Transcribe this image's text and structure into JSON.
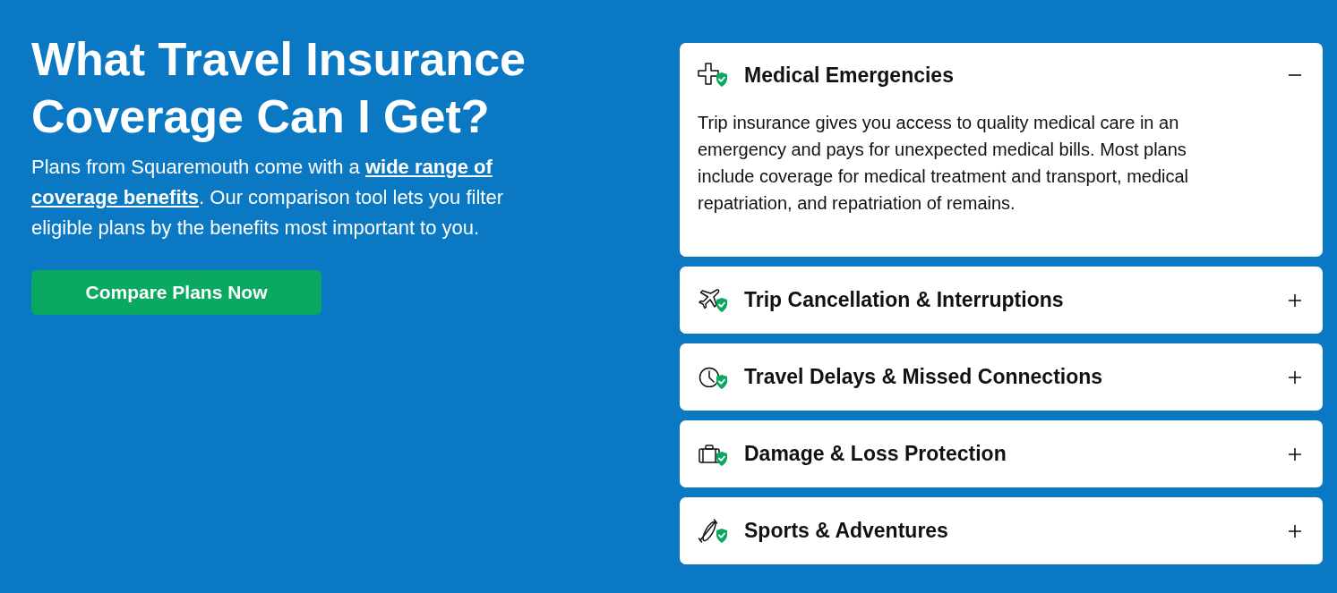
{
  "heading": {
    "title": "What Travel Insurance Coverage Can I Get?"
  },
  "intro": {
    "before": "Plans from Squaremouth come with a ",
    "link_parts": [
      "wide range of",
      "coverage benefits"
    ],
    "after": ". Our comparison tool lets you filter eligible plans by the benefits most important to you."
  },
  "cta": {
    "label": "Compare Plans Now"
  },
  "coverage_items": [
    {
      "title": "Medical Emergencies",
      "expanded": true,
      "body": "Trip insurance gives you access to quality medical care in an emergency and pays for unexpected medical bills. Most plans include coverage for medical treatment and transport, medical repatriation, and repatriation of remains."
    },
    {
      "title": "Trip Cancellation & Interruptions",
      "expanded": false
    },
    {
      "title": "Travel Delays & Missed Connections",
      "expanded": false
    },
    {
      "title": "Damage & Loss Protection",
      "expanded": false
    },
    {
      "title": "Sports & Adventures",
      "expanded": false
    }
  ]
}
